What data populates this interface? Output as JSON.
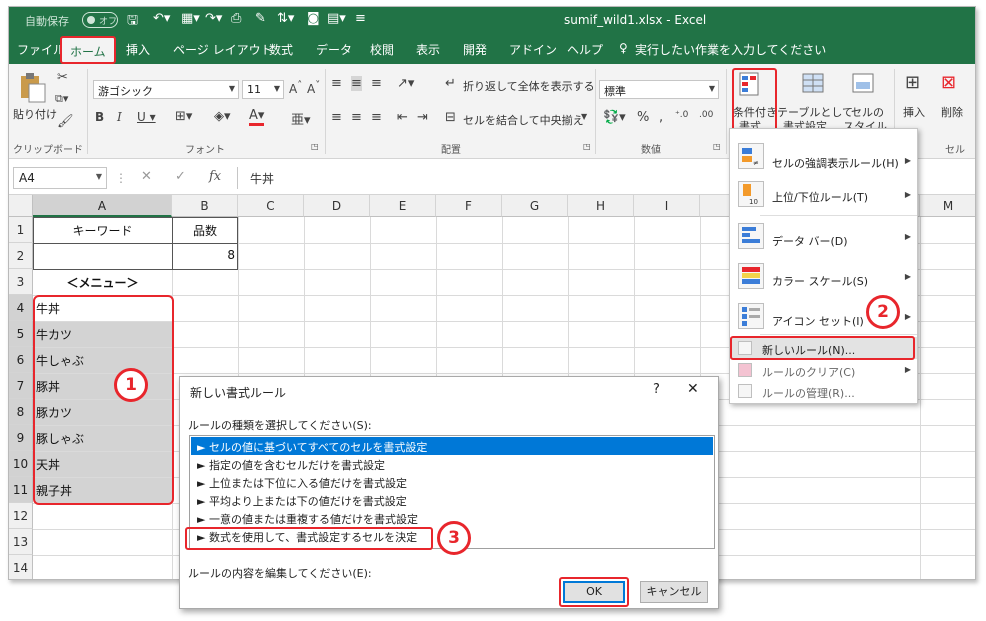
{
  "titlebar": {
    "autosave_label": "自動保存",
    "autosave_state": "オフ",
    "window_title": "sumif_wild1.xlsx  -  Excel"
  },
  "tabs": [
    {
      "label": "ファイル",
      "active": false
    },
    {
      "label": "ホーム",
      "active": true
    },
    {
      "label": "挿入",
      "active": false
    },
    {
      "label": "ページ レイアウト",
      "active": false
    },
    {
      "label": "数式",
      "active": false
    },
    {
      "label": "データ",
      "active": false
    },
    {
      "label": "校閲",
      "active": false
    },
    {
      "label": "表示",
      "active": false
    },
    {
      "label": "開発",
      "active": false
    },
    {
      "label": "アドイン",
      "active": false
    },
    {
      "label": "ヘルプ",
      "active": false
    }
  ],
  "tellme": "実行したい作業を入力してください",
  "ribbon": {
    "clipboard": {
      "paste": "貼り付け",
      "group": "クリップボード"
    },
    "font": {
      "name": "游ゴシック",
      "size": "11",
      "group": "フォント"
    },
    "alignment": {
      "wrap": "折り返して全体を表示する",
      "merge": "セルを結合して中央揃え",
      "group": "配置"
    },
    "number": {
      "format": "標準",
      "group": "数値"
    },
    "styles": {
      "conditional": "条件付き\n書式",
      "cond_line1": "条件付き",
      "cond_line2": "書式",
      "table_line1": "テーブルとして",
      "table_line2": "書式設定",
      "cellstyle_line1": "セルの",
      "cellstyle_line2": "スタイル"
    },
    "cells": {
      "insert": "挿入",
      "delete": "削除",
      "group": "セル"
    }
  },
  "formula_bar": {
    "name_box": "A4",
    "content": "牛丼"
  },
  "grid": {
    "columns": [
      "A",
      "B",
      "C",
      "D",
      "E",
      "F",
      "G",
      "H",
      "I",
      "M"
    ],
    "rows": [
      "1",
      "2",
      "3",
      "4",
      "5",
      "6",
      "7",
      "8",
      "9",
      "10",
      "11",
      "12",
      "13",
      "14"
    ],
    "cells": {
      "A1": "キーワード",
      "B1": "品数",
      "B2": "8",
      "A3": "＜メニュー＞",
      "A4": "牛丼",
      "A5": "牛カツ",
      "A6": "牛しゃぶ",
      "A7": "豚丼",
      "A8": "豚カツ",
      "A9": "豚しゃぶ",
      "A10": "天丼",
      "A11": "親子丼"
    }
  },
  "cf_menu": {
    "items": [
      "セルの強調表示ルール(H)",
      "上位/下位ルール(T)",
      "データ バー(D)",
      "カラー スケール(S)",
      "アイコン セット(I)",
      "新しいルール(N)...",
      "ルールのクリア(C)",
      "ルールの管理(R)..."
    ]
  },
  "dialog": {
    "title": "新しい書式ルール",
    "help": "?",
    "close": "✕",
    "select_label": "ルールの種類を選択してください(S):",
    "rules": [
      "► セルの値に基づいてすべてのセルを書式設定",
      "► 指定の値を含むセルだけを書式設定",
      "► 上位または下位に入る値だけを書式設定",
      "► 平均より上または下の値だけを書式設定",
      "► 一意の値または重複する値だけを書式設定",
      "► 数式を使用して、書式設定するセルを決定"
    ],
    "edit_label": "ルールの内容を編集してください(E):",
    "ok": "OK",
    "cancel": "キャンセル"
  },
  "callouts": [
    "1",
    "2",
    "3"
  ],
  "colors": {
    "excel_green": "#217346",
    "highlight_red": "#e8262c",
    "selection_blue": "#0078d7"
  }
}
